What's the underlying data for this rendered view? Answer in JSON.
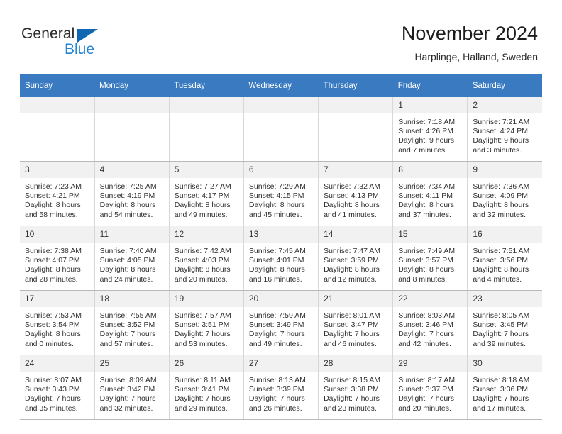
{
  "brand": {
    "name_top": "General",
    "name_bottom": "Blue",
    "triangle_color": "#1267b2",
    "blue_color": "#2284d4"
  },
  "header": {
    "title": "November 2024",
    "subtitle": "Harplinge, Halland, Sweden",
    "header_bg": "#3a7ac0",
    "daynum_bg": "#f1f1f1"
  },
  "weekdays": [
    "Sunday",
    "Monday",
    "Tuesday",
    "Wednesday",
    "Thursday",
    "Friday",
    "Saturday"
  ],
  "weeks": [
    [
      {
        "day": "",
        "empty": true,
        "sunrise": "",
        "sunset": "",
        "daylight_1": "",
        "daylight_2": ""
      },
      {
        "day": "",
        "empty": true,
        "sunrise": "",
        "sunset": "",
        "daylight_1": "",
        "daylight_2": ""
      },
      {
        "day": "",
        "empty": true,
        "sunrise": "",
        "sunset": "",
        "daylight_1": "",
        "daylight_2": ""
      },
      {
        "day": "",
        "empty": true,
        "sunrise": "",
        "sunset": "",
        "daylight_1": "",
        "daylight_2": ""
      },
      {
        "day": "",
        "empty": true,
        "sunrise": "",
        "sunset": "",
        "daylight_1": "",
        "daylight_2": ""
      },
      {
        "day": "1",
        "empty": false,
        "sunrise": "Sunrise: 7:18 AM",
        "sunset": "Sunset: 4:26 PM",
        "daylight_1": "Daylight: 9 hours",
        "daylight_2": "and 7 minutes."
      },
      {
        "day": "2",
        "empty": false,
        "sunrise": "Sunrise: 7:21 AM",
        "sunset": "Sunset: 4:24 PM",
        "daylight_1": "Daylight: 9 hours",
        "daylight_2": "and 3 minutes."
      }
    ],
    [
      {
        "day": "3",
        "empty": false,
        "sunrise": "Sunrise: 7:23 AM",
        "sunset": "Sunset: 4:21 PM",
        "daylight_1": "Daylight: 8 hours",
        "daylight_2": "and 58 minutes."
      },
      {
        "day": "4",
        "empty": false,
        "sunrise": "Sunrise: 7:25 AM",
        "sunset": "Sunset: 4:19 PM",
        "daylight_1": "Daylight: 8 hours",
        "daylight_2": "and 54 minutes."
      },
      {
        "day": "5",
        "empty": false,
        "sunrise": "Sunrise: 7:27 AM",
        "sunset": "Sunset: 4:17 PM",
        "daylight_1": "Daylight: 8 hours",
        "daylight_2": "and 49 minutes."
      },
      {
        "day": "6",
        "empty": false,
        "sunrise": "Sunrise: 7:29 AM",
        "sunset": "Sunset: 4:15 PM",
        "daylight_1": "Daylight: 8 hours",
        "daylight_2": "and 45 minutes."
      },
      {
        "day": "7",
        "empty": false,
        "sunrise": "Sunrise: 7:32 AM",
        "sunset": "Sunset: 4:13 PM",
        "daylight_1": "Daylight: 8 hours",
        "daylight_2": "and 41 minutes."
      },
      {
        "day": "8",
        "empty": false,
        "sunrise": "Sunrise: 7:34 AM",
        "sunset": "Sunset: 4:11 PM",
        "daylight_1": "Daylight: 8 hours",
        "daylight_2": "and 37 minutes."
      },
      {
        "day": "9",
        "empty": false,
        "sunrise": "Sunrise: 7:36 AM",
        "sunset": "Sunset: 4:09 PM",
        "daylight_1": "Daylight: 8 hours",
        "daylight_2": "and 32 minutes."
      }
    ],
    [
      {
        "day": "10",
        "empty": false,
        "sunrise": "Sunrise: 7:38 AM",
        "sunset": "Sunset: 4:07 PM",
        "daylight_1": "Daylight: 8 hours",
        "daylight_2": "and 28 minutes."
      },
      {
        "day": "11",
        "empty": false,
        "sunrise": "Sunrise: 7:40 AM",
        "sunset": "Sunset: 4:05 PM",
        "daylight_1": "Daylight: 8 hours",
        "daylight_2": "and 24 minutes."
      },
      {
        "day": "12",
        "empty": false,
        "sunrise": "Sunrise: 7:42 AM",
        "sunset": "Sunset: 4:03 PM",
        "daylight_1": "Daylight: 8 hours",
        "daylight_2": "and 20 minutes."
      },
      {
        "day": "13",
        "empty": false,
        "sunrise": "Sunrise: 7:45 AM",
        "sunset": "Sunset: 4:01 PM",
        "daylight_1": "Daylight: 8 hours",
        "daylight_2": "and 16 minutes."
      },
      {
        "day": "14",
        "empty": false,
        "sunrise": "Sunrise: 7:47 AM",
        "sunset": "Sunset: 3:59 PM",
        "daylight_1": "Daylight: 8 hours",
        "daylight_2": "and 12 minutes."
      },
      {
        "day": "15",
        "empty": false,
        "sunrise": "Sunrise: 7:49 AM",
        "sunset": "Sunset: 3:57 PM",
        "daylight_1": "Daylight: 8 hours",
        "daylight_2": "and 8 minutes."
      },
      {
        "day": "16",
        "empty": false,
        "sunrise": "Sunrise: 7:51 AM",
        "sunset": "Sunset: 3:56 PM",
        "daylight_1": "Daylight: 8 hours",
        "daylight_2": "and 4 minutes."
      }
    ],
    [
      {
        "day": "17",
        "empty": false,
        "sunrise": "Sunrise: 7:53 AM",
        "sunset": "Sunset: 3:54 PM",
        "daylight_1": "Daylight: 8 hours",
        "daylight_2": "and 0 minutes."
      },
      {
        "day": "18",
        "empty": false,
        "sunrise": "Sunrise: 7:55 AM",
        "sunset": "Sunset: 3:52 PM",
        "daylight_1": "Daylight: 7 hours",
        "daylight_2": "and 57 minutes."
      },
      {
        "day": "19",
        "empty": false,
        "sunrise": "Sunrise: 7:57 AM",
        "sunset": "Sunset: 3:51 PM",
        "daylight_1": "Daylight: 7 hours",
        "daylight_2": "and 53 minutes."
      },
      {
        "day": "20",
        "empty": false,
        "sunrise": "Sunrise: 7:59 AM",
        "sunset": "Sunset: 3:49 PM",
        "daylight_1": "Daylight: 7 hours",
        "daylight_2": "and 49 minutes."
      },
      {
        "day": "21",
        "empty": false,
        "sunrise": "Sunrise: 8:01 AM",
        "sunset": "Sunset: 3:47 PM",
        "daylight_1": "Daylight: 7 hours",
        "daylight_2": "and 46 minutes."
      },
      {
        "day": "22",
        "empty": false,
        "sunrise": "Sunrise: 8:03 AM",
        "sunset": "Sunset: 3:46 PM",
        "daylight_1": "Daylight: 7 hours",
        "daylight_2": "and 42 minutes."
      },
      {
        "day": "23",
        "empty": false,
        "sunrise": "Sunrise: 8:05 AM",
        "sunset": "Sunset: 3:45 PM",
        "daylight_1": "Daylight: 7 hours",
        "daylight_2": "and 39 minutes."
      }
    ],
    [
      {
        "day": "24",
        "empty": false,
        "sunrise": "Sunrise: 8:07 AM",
        "sunset": "Sunset: 3:43 PM",
        "daylight_1": "Daylight: 7 hours",
        "daylight_2": "and 35 minutes."
      },
      {
        "day": "25",
        "empty": false,
        "sunrise": "Sunrise: 8:09 AM",
        "sunset": "Sunset: 3:42 PM",
        "daylight_1": "Daylight: 7 hours",
        "daylight_2": "and 32 minutes."
      },
      {
        "day": "26",
        "empty": false,
        "sunrise": "Sunrise: 8:11 AM",
        "sunset": "Sunset: 3:41 PM",
        "daylight_1": "Daylight: 7 hours",
        "daylight_2": "and 29 minutes."
      },
      {
        "day": "27",
        "empty": false,
        "sunrise": "Sunrise: 8:13 AM",
        "sunset": "Sunset: 3:39 PM",
        "daylight_1": "Daylight: 7 hours",
        "daylight_2": "and 26 minutes."
      },
      {
        "day": "28",
        "empty": false,
        "sunrise": "Sunrise: 8:15 AM",
        "sunset": "Sunset: 3:38 PM",
        "daylight_1": "Daylight: 7 hours",
        "daylight_2": "and 23 minutes."
      },
      {
        "day": "29",
        "empty": false,
        "sunrise": "Sunrise: 8:17 AM",
        "sunset": "Sunset: 3:37 PM",
        "daylight_1": "Daylight: 7 hours",
        "daylight_2": "and 20 minutes."
      },
      {
        "day": "30",
        "empty": false,
        "sunrise": "Sunrise: 8:18 AM",
        "sunset": "Sunset: 3:36 PM",
        "daylight_1": "Daylight: 7 hours",
        "daylight_2": "and 17 minutes."
      }
    ]
  ]
}
